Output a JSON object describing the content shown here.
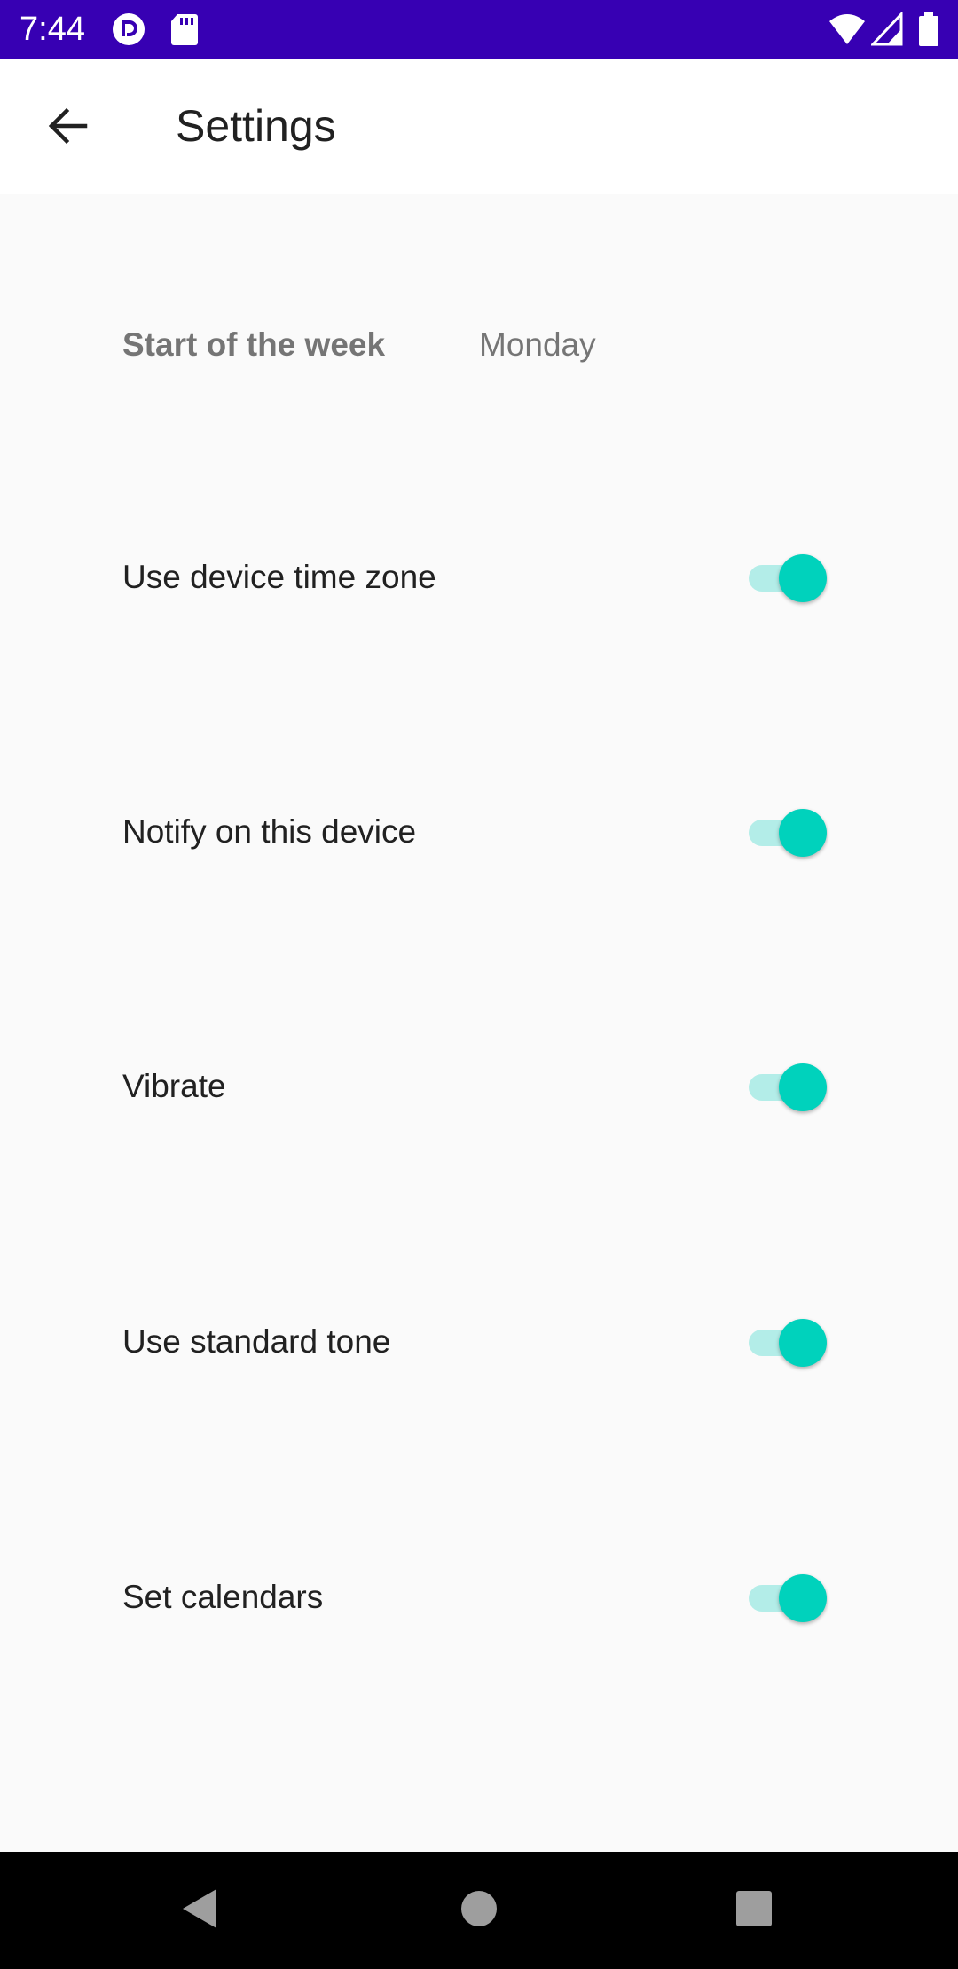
{
  "status_bar": {
    "time": "7:44",
    "icons": [
      "pocket-casts-icon",
      "sd-card-icon",
      "wifi-icon",
      "cell-signal-icon",
      "battery-icon"
    ],
    "background": "#3700b3"
  },
  "app_bar": {
    "back_icon": "arrow-back-icon",
    "title": "Settings"
  },
  "start_of_week": {
    "label": "Start of the week",
    "value": "Monday"
  },
  "settings": [
    {
      "label": "Use device time zone",
      "enabled": true
    },
    {
      "label": "Notify on this device",
      "enabled": true
    },
    {
      "label": "Vibrate",
      "enabled": true
    },
    {
      "label": "Use standard tone",
      "enabled": true
    },
    {
      "label": "Set calendars",
      "enabled": true
    }
  ],
  "colors": {
    "accent": "#00d2bc",
    "switch_track": "#b3ede8"
  },
  "nav_bar": {
    "icons": [
      "back-triangle-icon",
      "home-circle-icon",
      "recents-square-icon"
    ]
  }
}
